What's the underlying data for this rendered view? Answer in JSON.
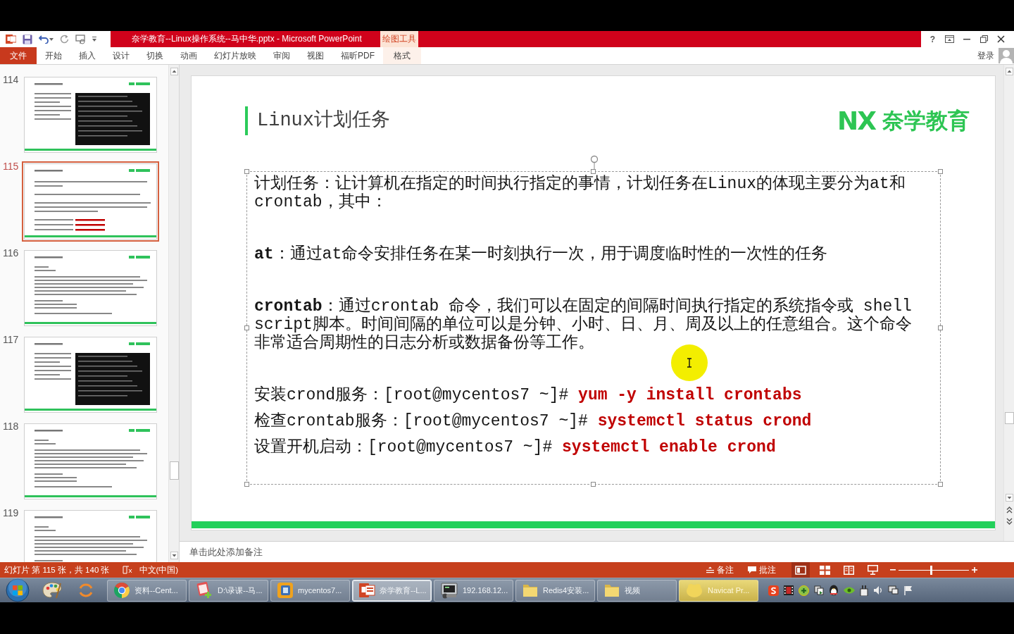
{
  "title_bar": {
    "title": "奈学教育--Linux操作系统--马中华.pptx - Microsoft PowerPoint",
    "contextual_group": "绘图工具",
    "help": "?"
  },
  "ribbon": {
    "tabs": [
      {
        "label": "文件",
        "kind": "file"
      },
      {
        "label": "开始",
        "kind": "standard"
      },
      {
        "label": "插入",
        "kind": "standard"
      },
      {
        "label": "设计",
        "kind": "standard"
      },
      {
        "label": "切换",
        "kind": "standard"
      },
      {
        "label": "动画",
        "kind": "standard"
      },
      {
        "label": "幻灯片放映",
        "kind": "standard"
      },
      {
        "label": "审阅",
        "kind": "standard"
      },
      {
        "label": "视图",
        "kind": "standard"
      },
      {
        "label": "福昕PDF",
        "kind": "standard"
      },
      {
        "label": "格式",
        "kind": "contextual"
      }
    ],
    "sign_in": "登录"
  },
  "thumbnails": [
    {
      "number": "114",
      "kind": "terminal",
      "selected": false
    },
    {
      "number": "115",
      "kind": "commands",
      "selected": true
    },
    {
      "number": "116",
      "kind": "text",
      "selected": false
    },
    {
      "number": "117",
      "kind": "terminal",
      "selected": false
    },
    {
      "number": "118",
      "kind": "text",
      "selected": false
    },
    {
      "number": "119",
      "kind": "text",
      "selected": false
    }
  ],
  "slide": {
    "title": "Linux计划任务",
    "logo_mark": "NX",
    "logo_text": "奈学教育",
    "textbox": {
      "selected": true,
      "paragraphs": [
        {
          "kind": "text",
          "text": "计划任务：让计算机在指定的时间执行指定的事情，计划任务在Linux的体现主要分为at和crontab，其中："
        },
        {
          "kind": "text",
          "text": "**at**：通过at命令安排任务在某一时刻执行一次，用于调度临时性的一次性的任务"
        },
        {
          "kind": "text",
          "text": "**crontab**：通过crontab 命令，我们可以在固定的间隔时间执行指定的系统指令或 shell script脚本。时间间隔的单位可以是分钟、小时、日、月、周及以上的任意组合。这个命令非常适合周期性的日志分析或数据备份等工作。"
        },
        {
          "kind": "command",
          "label": "安装crond服务：",
          "prompt": "[root@mycentos7 ~]#",
          "command": "yum -y install crontabs"
        },
        {
          "kind": "command",
          "label": "检查crontab服务：",
          "prompt": "[root@mycentos7 ~]#",
          "command": "systemctl status crond"
        },
        {
          "kind": "command",
          "label": "设置开机启动：",
          "prompt": "[root@mycentos7 ~]#",
          "command": "systemctl enable crond"
        }
      ]
    }
  },
  "notes": {
    "placeholder": "单击此处添加备注"
  },
  "status_bar": {
    "slide_info": "幻灯片 第 115 张，共 140 张",
    "language": "中文(中国)",
    "notes_button": "备注",
    "comments_button": "批注",
    "views": [
      {
        "kind": "normal",
        "selected": true
      },
      {
        "kind": "sorter",
        "selected": false
      },
      {
        "kind": "reading",
        "selected": false
      },
      {
        "kind": "slideshow",
        "selected": false
      }
    ],
    "zoom": {
      "level": 0.46
    }
  },
  "taskbar": {
    "buttons": [
      {
        "label": "资料--Cent...",
        "kind": "browser",
        "selected": false,
        "flashing": false
      },
      {
        "label": "D:\\录课--马...",
        "kind": "notepad",
        "selected": false,
        "flashing": false
      },
      {
        "label": "mycentos7...",
        "kind": "vm",
        "selected": false,
        "flashing": false
      },
      {
        "label": "奈学教育--L...",
        "kind": "slides",
        "selected": true,
        "flashing": false
      },
      {
        "label": "192.168.12...",
        "kind": "terminal",
        "selected": false,
        "flashing": false
      },
      {
        "label": "Redis4安装...",
        "kind": "folder",
        "selected": false,
        "flashing": false
      },
      {
        "label": "视频",
        "kind": "folder",
        "selected": false,
        "flashing": false
      },
      {
        "label": "Navicat Pr...",
        "kind": "database",
        "selected": false,
        "flashing": true
      }
    ]
  }
}
